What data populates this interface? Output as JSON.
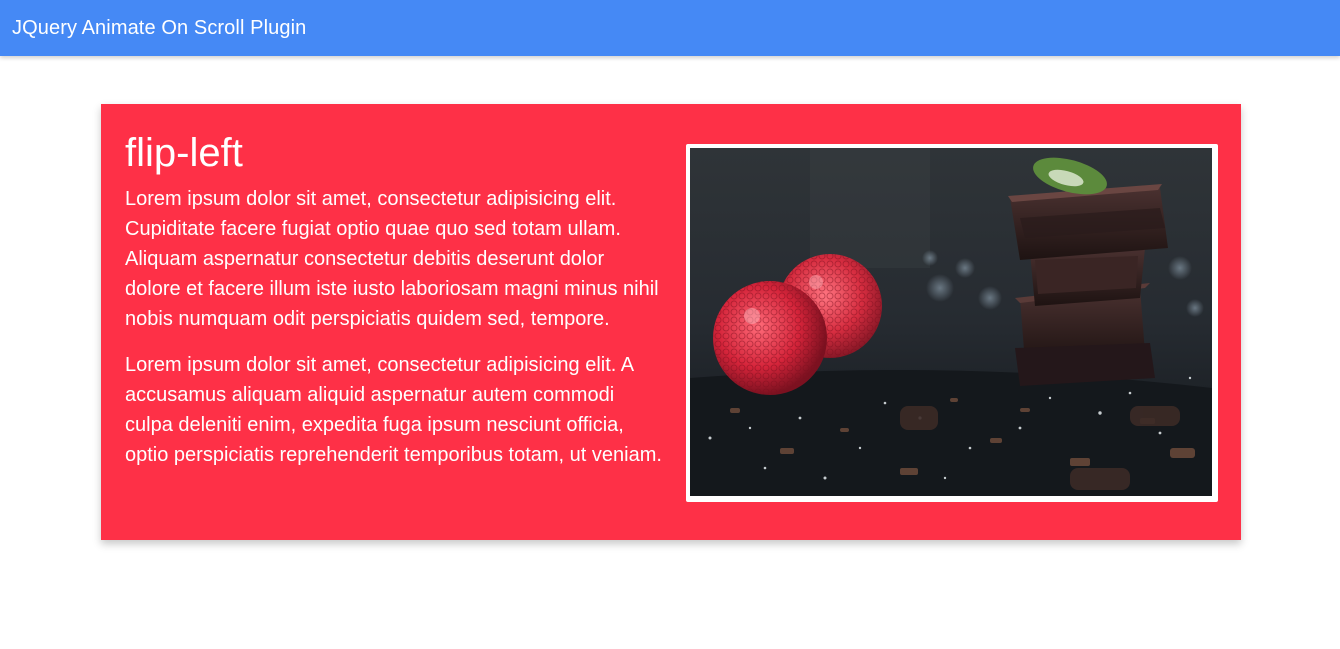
{
  "header": {
    "title": "JQuery Animate On Scroll Plugin",
    "background_color": "#4589f5"
  },
  "card": {
    "background_color": "#fe3047",
    "title": "flip-left",
    "paragraphs": [
      "Lorem ipsum dolor sit amet, consectetur adipisicing elit. Cupiditate facere fugiat optio quae quo sed totam ullam. Aliquam aspernatur consectetur debitis deserunt dolor dolore et facere illum iste iusto laboriosam magni minus nihil nobis numquam odit perspiciatis quidem sed, tempore.",
      "Lorem ipsum dolor sit amet, consectetur adipisicing elit. A accusamus aliquam aliquid aspernatur autem commodi culpa deleniti enim, expedita fuga ipsum nesciunt officia, optio perspiciatis reprehenderit temporibus totam, ut veniam."
    ],
    "image": {
      "subject": "raspberries-and-chocolate-photo"
    }
  }
}
